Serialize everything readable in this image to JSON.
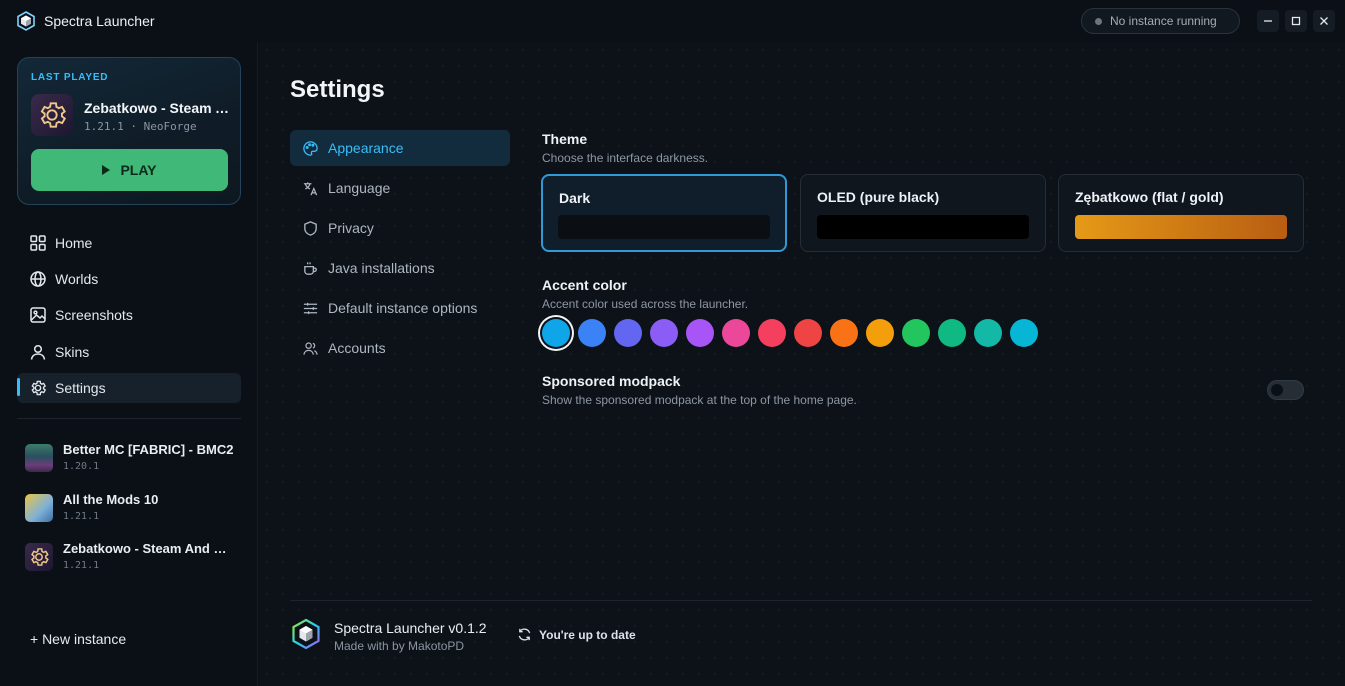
{
  "titlebar": {
    "app_title": "Spectra Launcher",
    "status_text": "No instance running"
  },
  "last_played": {
    "label": "LAST PLAYED",
    "name": "Zebatkowo - Steam And Sorcery",
    "meta": "1.21.1 · NeoForge",
    "play_label": "PLAY"
  },
  "nav": {
    "items": [
      {
        "label": "Home",
        "icon": "grid-icon"
      },
      {
        "label": "Worlds",
        "icon": "globe-icon"
      },
      {
        "label": "Screenshots",
        "icon": "image-icon"
      },
      {
        "label": "Skins",
        "icon": "user-icon"
      },
      {
        "label": "Settings",
        "icon": "gear-icon",
        "active": true
      }
    ]
  },
  "instances": [
    {
      "name": "Better MC [FABRIC] - BMC2",
      "version": "1.20.1"
    },
    {
      "name": "All the Mods 10",
      "version": "1.21.1"
    },
    {
      "name": "Zebatkowo - Steam And Sorcery",
      "version": "1.21.1"
    }
  ],
  "new_instance_label": "+ New instance",
  "settings": {
    "title": "Settings",
    "tabs": [
      {
        "label": "Appearance",
        "icon": "palette-icon",
        "active": true
      },
      {
        "label": "Language",
        "icon": "translate-icon"
      },
      {
        "label": "Privacy",
        "icon": "shield-icon"
      },
      {
        "label": "Java installations",
        "icon": "coffee-icon"
      },
      {
        "label": "Default instance options",
        "icon": "sliders-icon"
      },
      {
        "label": "Accounts",
        "icon": "users-icon"
      }
    ],
    "theme": {
      "title": "Theme",
      "description": "Choose the interface darkness.",
      "options": [
        {
          "label": "Dark",
          "selected": true
        },
        {
          "label": "OLED (pure black)"
        },
        {
          "label": "Zębatkowo (flat / gold)"
        }
      ]
    },
    "accent": {
      "title": "Accent color",
      "description": "Accent color used across the launcher.",
      "colors": [
        "#0ea5e9",
        "#3b82f6",
        "#6366f1",
        "#8b5cf6",
        "#a855f7",
        "#ec4899",
        "#f43f5e",
        "#ef4444",
        "#f97316",
        "#f59e0b",
        "#22c55e",
        "#10b981",
        "#14b8a6",
        "#06b6d4"
      ],
      "selected_index": 0
    },
    "sponsored": {
      "title": "Sponsored modpack",
      "description": "Show the sponsored modpack at the top of the home page.",
      "enabled": false
    }
  },
  "footer": {
    "name": "Spectra Launcher v0.1.2",
    "credit": "Made with by MakotoPD",
    "update_status": "You're up to date"
  }
}
